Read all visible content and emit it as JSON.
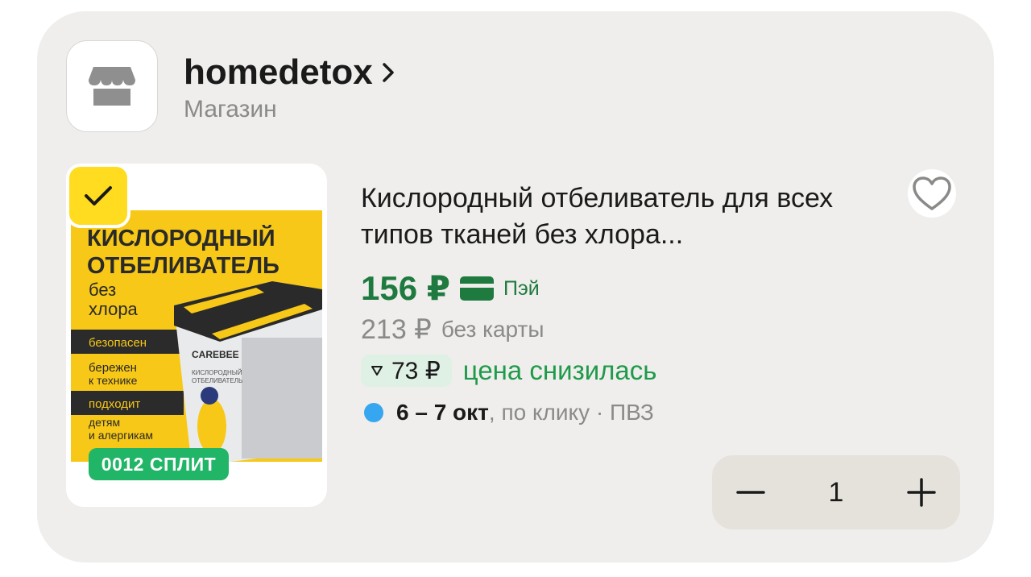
{
  "shop": {
    "name": "homedetox",
    "subtitle": "Магазин",
    "logo_icon": "storefront-icon"
  },
  "product": {
    "title": "Кислородный отбеливатель для всех типов тканей без хлора...",
    "selected": true,
    "split_badge": "0012 СПЛИТ",
    "image": {
      "line1": "КИСЛОРОДНЫЙ",
      "line2": "ОТБЕЛИВАТЕЛЬ",
      "line3": "без",
      "line4": "хлора",
      "tag1": "безопасен",
      "tag2a": "бережен",
      "tag2b": "к технике",
      "tag3": "подходит",
      "tag4a": "детям",
      "tag4b": "и алергикам",
      "brand": "CAREBEE",
      "jar_text1": "КИСЛОРОДНЫЙ",
      "jar_text2": "ОТБЕЛИВАТЕЛЬ"
    }
  },
  "pricing": {
    "price": "156 ₽",
    "pay_label": "Пэй",
    "old_price": "213 ₽",
    "old_label": "без карты",
    "drop_amount": "73 ₽",
    "drop_text": "цена снизилась"
  },
  "delivery": {
    "dates": "6 – 7 окт",
    "method": ", по клику · ПВЗ"
  },
  "stepper": {
    "quantity": "1"
  },
  "colors": {
    "price_green": "#1f7a3f",
    "drop_green": "#1f9a4b",
    "yellow": "#ffdc1f",
    "split_green": "#21b567",
    "delivery_dot": "#36a6f0"
  }
}
